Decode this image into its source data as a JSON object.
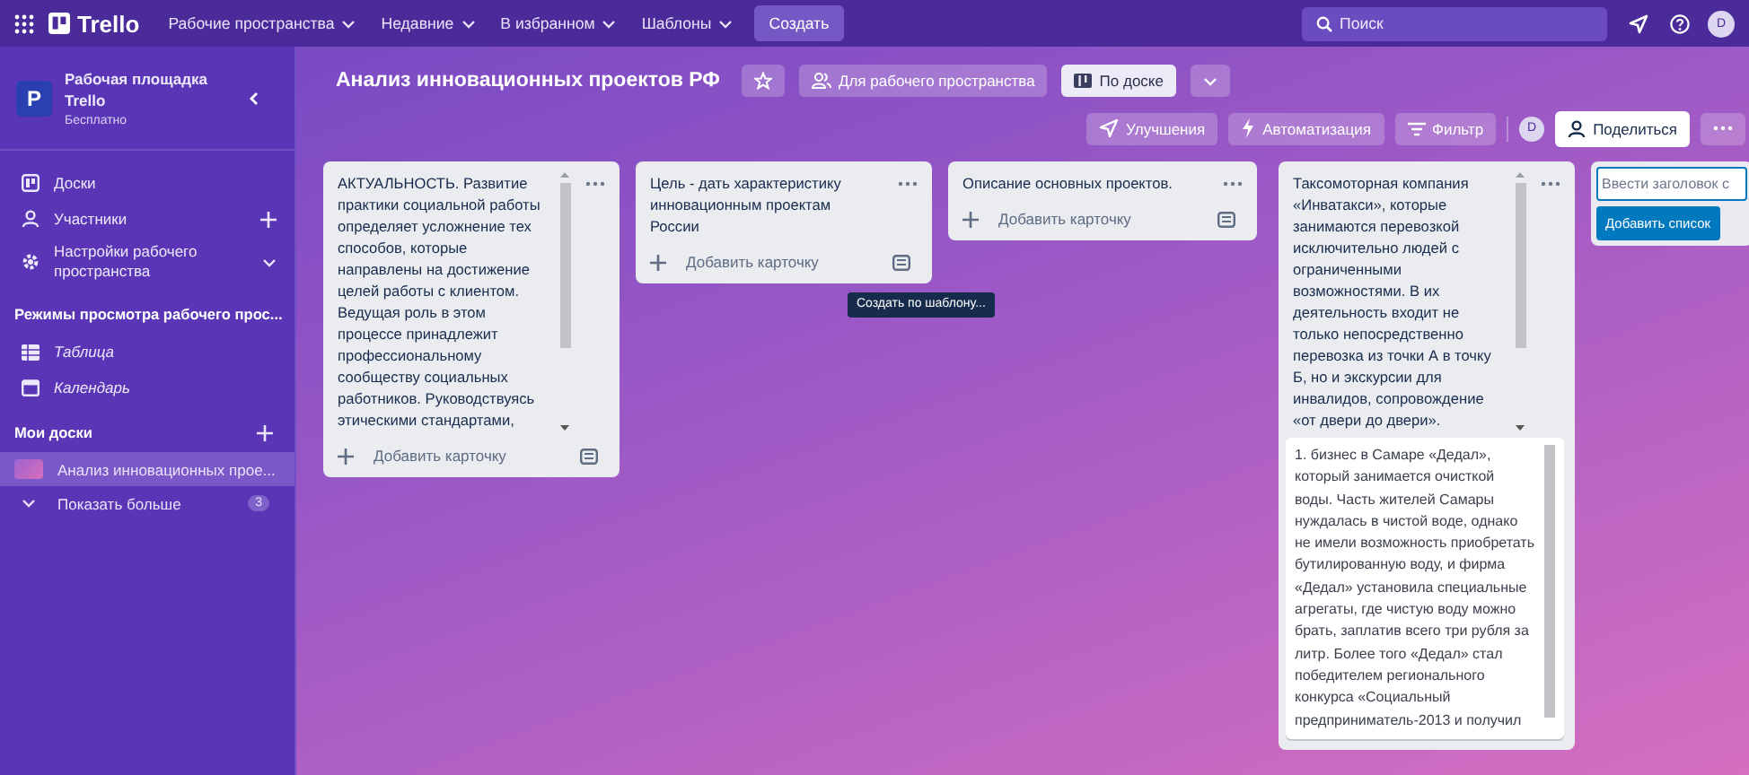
{
  "topbar": {
    "brand": "Trello",
    "menus": [
      {
        "label": "Рабочие пространства"
      },
      {
        "label": "Недавние"
      },
      {
        "label": "В избранном"
      },
      {
        "label": "Шаблоны"
      }
    ],
    "create": "Создать",
    "search": {
      "placeholder": "Поиск"
    },
    "avatar": "D"
  },
  "sidebar": {
    "workspace": {
      "letter": "P",
      "name": "Рабочая площадка Trello",
      "plan": "Бесплатно"
    },
    "items": [
      {
        "label": "Доски"
      },
      {
        "label": "Участники"
      },
      {
        "label": "Настройки рабочего пространства"
      }
    ],
    "views_heading": "Режимы просмотра рабочего прос...",
    "views": [
      {
        "label": "Таблица"
      },
      {
        "label": "Календарь"
      }
    ],
    "boards_heading": "Мои доски",
    "boards": [
      {
        "label": "Анализ инновационных прое...",
        "selected": true
      }
    ],
    "show_more": {
      "label": "Показать больше",
      "count": "3"
    }
  },
  "board": {
    "title": "Анализ инновационных проектов РФ",
    "visibility": "Для рабочего пространства",
    "view": "По доске",
    "actions": [
      {
        "label": "Улучшения"
      },
      {
        "label": "Автоматизация"
      },
      {
        "label": "Фильтр"
      }
    ],
    "member": "D",
    "share": "Поделиться"
  },
  "lists": [
    {
      "title": "АКТУАЛЬНОСТЬ. Развитие практики социальной работы определяет усложнение тех способов, которые направлены на достижение целей работы с клиентом. Ведущая роль в этом процессе принадлежит профессиональному сообществу социальных работников. Руководствуясь этическими стандартами,",
      "scrollable": true,
      "add_card": "Добавить карточку"
    },
    {
      "title": "Цель - дать характеристику инновационным проектам России",
      "scrollable": false,
      "add_card": "Добавить карточку",
      "tooltip": "Создать по шаблону..."
    },
    {
      "title": "Описание основных проектов.",
      "scrollable": false,
      "add_card": "Добавить карточку"
    },
    {
      "title": "Таксомоторная компания «Инватакси», которые занимаются перевозкой исключительно людей с ограниченными возможностями. В их деятельность входит не только непосредственно перевозка из точки А в точку Б, но и экскурсии для инвалидов, сопровождение «от двери до двери».",
      "scrollable": true,
      "cards": [
        {
          "text": "1. бизнес в Самаре «Дедал», который занимается очисткой воды. Часть жителей Самары нуждалась в чистой воде, однако не имели возможность приобретать бутилированную воду, и фирма «Дедал» установила специальные агрегаты, где чистую воду можно брать, заплатив всего три рубля за литр. Более того «Дедал» стал победителем регионального конкурса «Социальный предприниматель-2013 и получил"
        }
      ]
    }
  ],
  "add_list": {
    "placeholder": "Ввести заголовок с",
    "button": "Добавить список"
  }
}
